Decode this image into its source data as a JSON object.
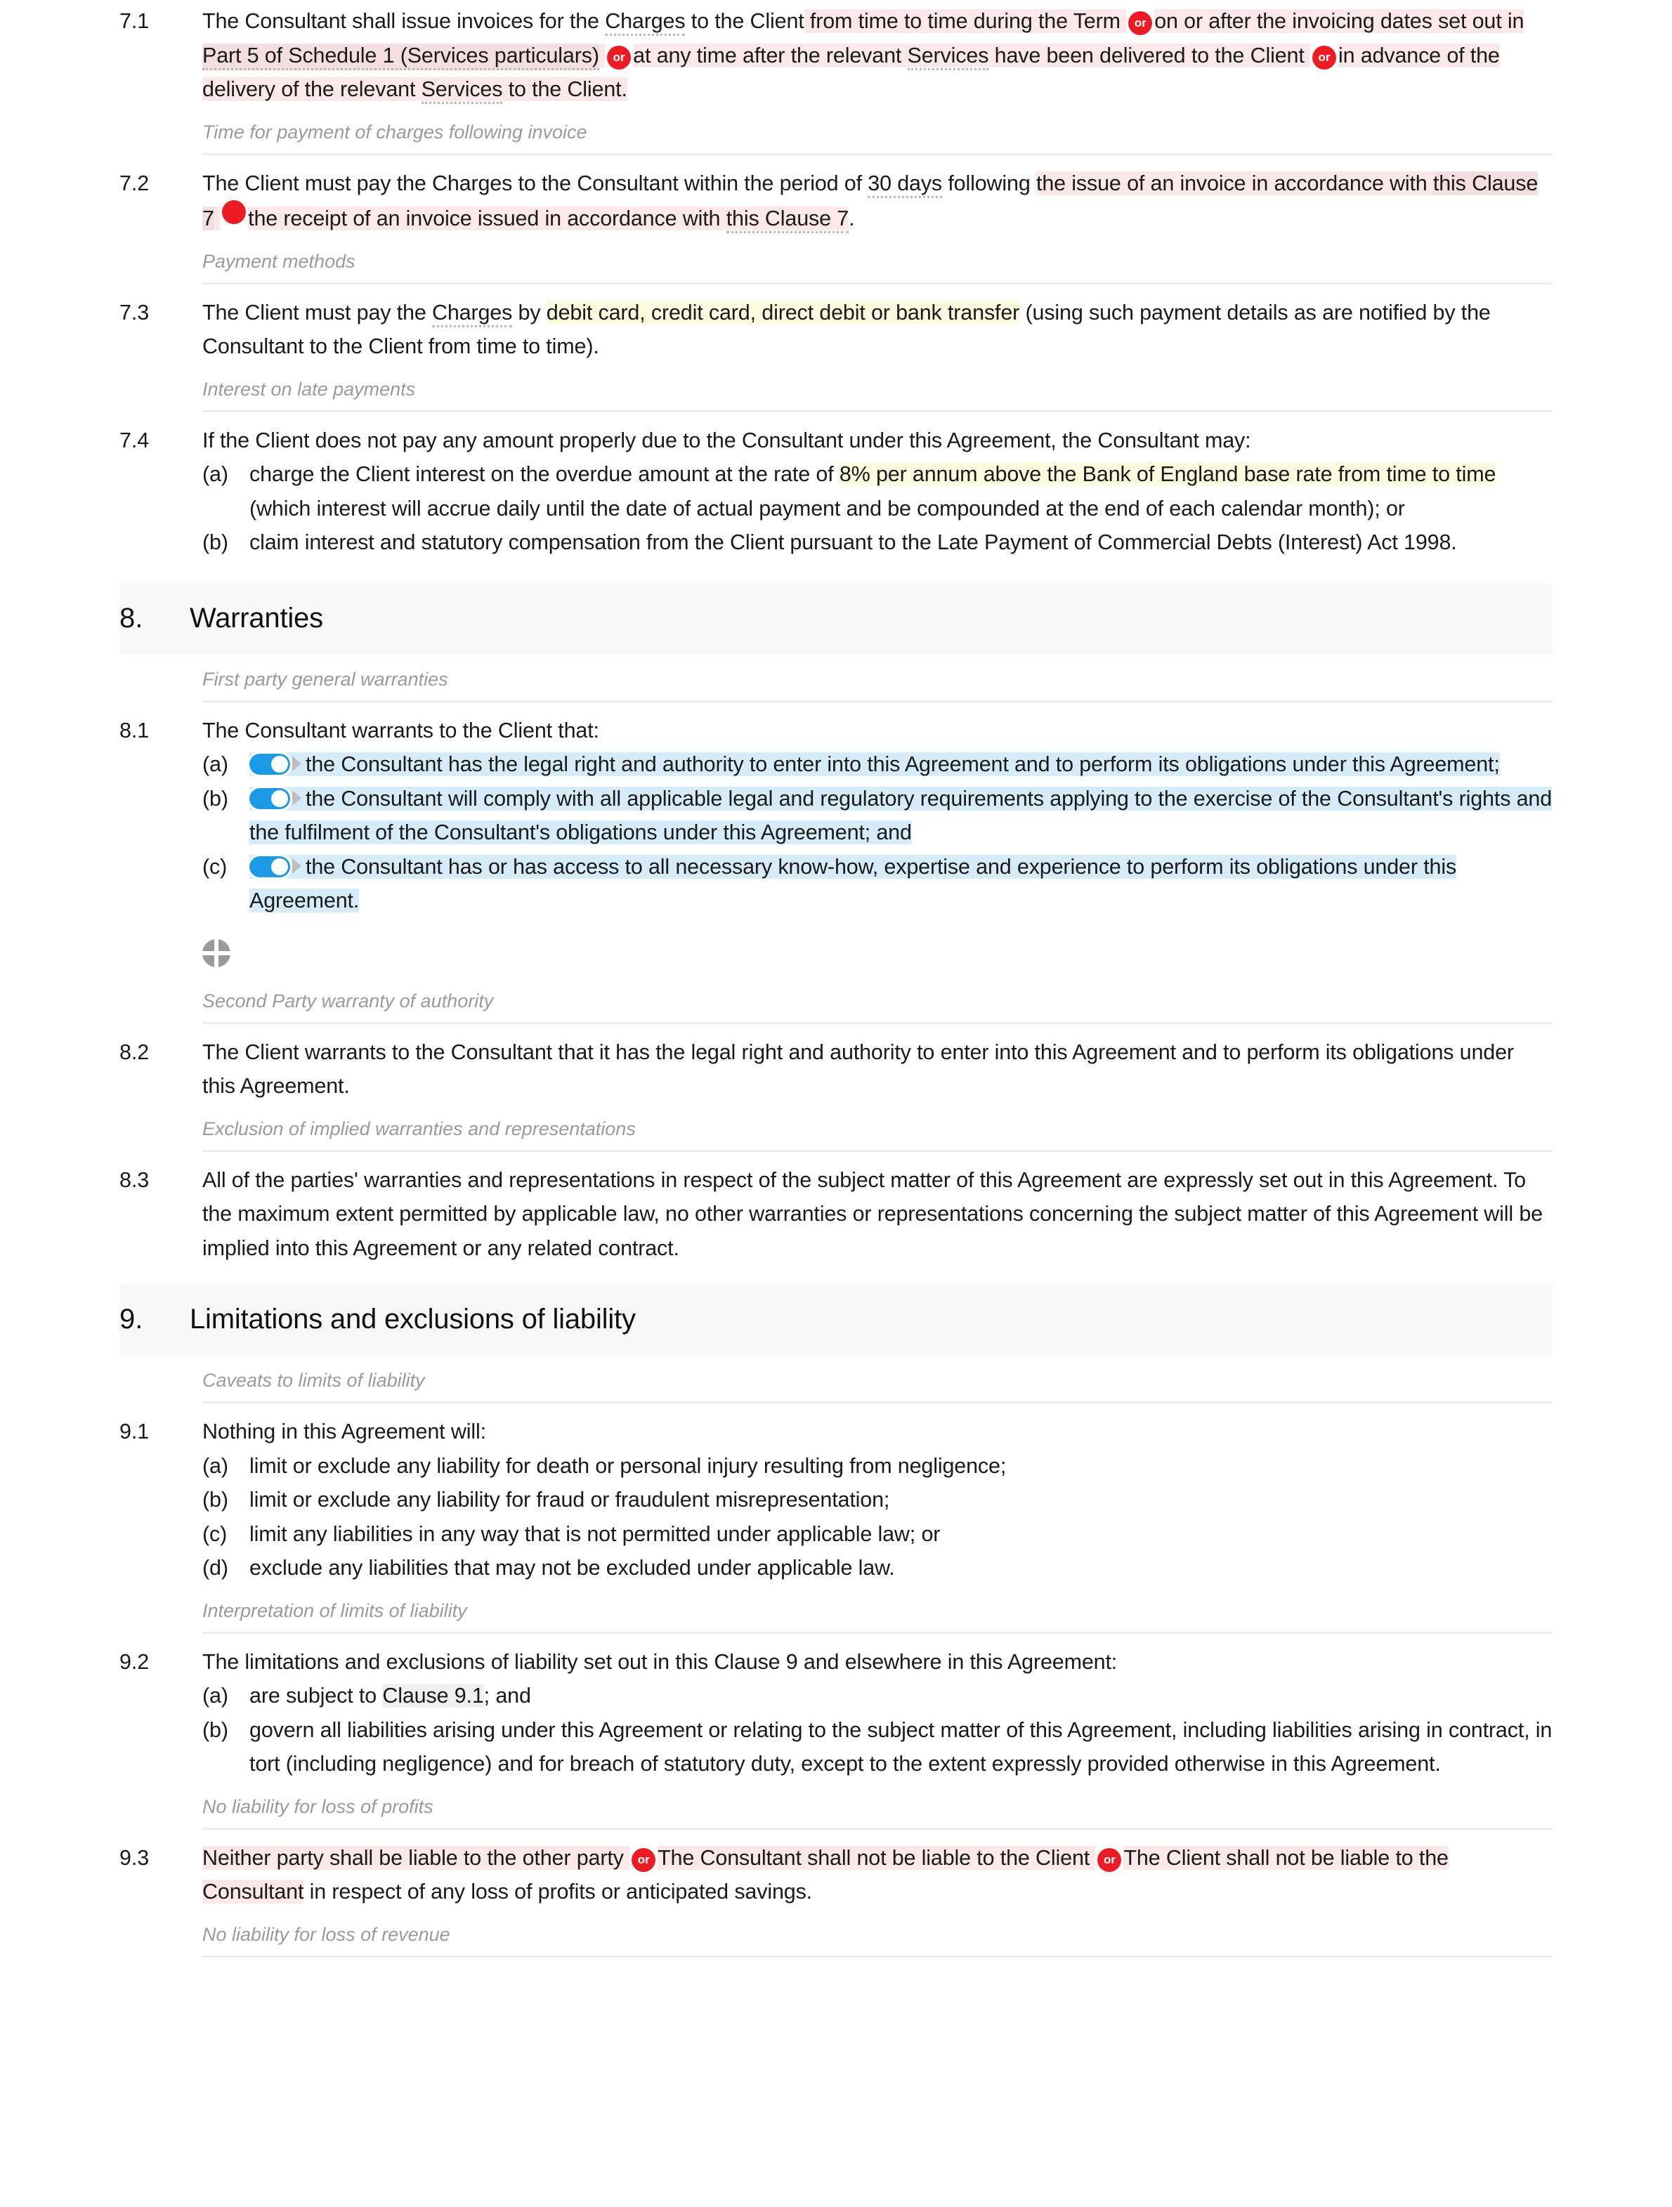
{
  "document": {
    "type": "legal-agreement-editor",
    "clauses": {
      "c71": {
        "number": "7.1",
        "p1": "The Consultant shall issue invoices for the ",
        "term_charges": "Charges",
        "p2": " to the ",
        "term_client": "Client",
        "opt1": "from time to time during the Term",
        "or": "or",
        "opt2a": "on or after the invoicing dates set out in ",
        "xref1": "Part 5 of Schedule 1 (Services particulars)",
        "opt3a": "at any time after the relevant ",
        "term_services": "Services",
        "opt3b": " have been delivered to the ",
        "term_client2": "Client",
        "opt4a": "in advance of the delivery of the relevant ",
        "term_services2": "Services",
        "opt4b": " to the Client."
      },
      "c72": {
        "number": "7.2",
        "p1": "The Client must pay the Charges to the Consultant within the period of ",
        "days": "30 days",
        "p2": " following ",
        "opt1a": "the issue of an invoice in accordance with ",
        "xref1": "this Clause 7",
        "opt2a": "the receipt of an invoice issued in accordance with ",
        "xref2": "this Clause 7",
        "tail": "."
      },
      "c73": {
        "number": "7.3",
        "p1": "The Client must pay the ",
        "term_charges": "Charges",
        "p2": " by ",
        "methods": "debit card, credit card, direct debit or bank transfer",
        "p3": " (using such payment details as are notified by the Consultant to the Client from time to time)."
      },
      "c74": {
        "number": "7.4",
        "lead": "If the Client does not pay any amount properly due to the Consultant under this Agreement, the Consultant may:",
        "items": [
          {
            "label": "(a)",
            "pre": "charge the Client interest on the overdue amount at the rate of ",
            "highlight": "8% per annum above the Bank of England base rate from time to time",
            "post": " (which interest will accrue daily until the date of actual payment and be compounded at the end of each calendar month); or"
          },
          {
            "label": "(b)",
            "pre": "claim interest and statutory compensation from the Client pursuant to the Late Payment of Commercial Debts (Interest) Act 1998.",
            "highlight": "",
            "post": ""
          }
        ]
      },
      "c81": {
        "number": "8.1",
        "lead": "The Consultant warrants to the Client that:",
        "items": [
          {
            "label": "(a)",
            "text": "the Consultant has the legal right and authority to enter into this Agreement and to perform its obligations under this Agreement;"
          },
          {
            "label": "(b)",
            "text": "the Consultant will comply with all applicable legal and regulatory requirements applying to the exercise of the Consultant's rights and the fulfilment of the Consultant's obligations under this Agreement; and"
          },
          {
            "label": "(c)",
            "text": "the Consultant has or has access to all necessary know-how, expertise and experience to perform its obligations under this Agreement."
          }
        ]
      },
      "c82": {
        "number": "8.2",
        "text": "The Client warrants to the Consultant that it has the legal right and authority to enter into this Agreement and to perform its obligations under this Agreement."
      },
      "c83": {
        "number": "8.3",
        "text": "All of the parties' warranties and representations in respect of the subject matter of this Agreement are expressly set out in this Agreement. To the maximum extent permitted by applicable law, no other warranties or representations concerning the subject matter of this Agreement will be implied into this Agreement or any related contract."
      },
      "c91": {
        "number": "9.1",
        "lead": "Nothing in this Agreement will:",
        "items": [
          {
            "label": "(a)",
            "text": "limit or exclude any liability for death or personal injury resulting from negligence;"
          },
          {
            "label": "(b)",
            "text": "limit or exclude any liability for fraud or fraudulent misrepresentation;"
          },
          {
            "label": "(c)",
            "text": "limit any liabilities in any way that is not permitted under applicable law; or"
          },
          {
            "label": "(d)",
            "text": "exclude any liabilities that may not be excluded under applicable law."
          }
        ]
      },
      "c92": {
        "number": "9.2",
        "lead": "The limitations and exclusions of liability set out in this Clause 9 and elsewhere in this Agreement:",
        "item_a_pre": "are subject to ",
        "item_a_xref": "Clause 9.1",
        "item_a_post": "; and",
        "item_a_label": "(a)",
        "item_b_label": "(b)",
        "item_b": "govern all liabilities arising under this Agreement or relating to the subject matter of this Agreement, including liabilities arising in contract, in tort (including negligence) and for breach of statutory duty, except to the extent expressly provided otherwise in this Agreement."
      },
      "c93": {
        "number": "9.3",
        "opt1": "Neither party shall be liable to the other party",
        "or": "or",
        "opt2": "The Consultant shall not be liable to the Client",
        "opt3": "The Client shall not be liable to the Consultant",
        "tail": " in respect of any loss of profits or anticipated savings."
      }
    },
    "sections": [
      {
        "number": "8.",
        "title": "Warranties"
      },
      {
        "number": "9.",
        "title": "Limitations and exclusions of liability"
      }
    ],
    "subheadings": {
      "s1": "Time for payment of charges following invoice",
      "s2": "Payment methods",
      "s3": "Interest on late payments",
      "s4": "First party general warranties",
      "s5": "Second Party warranty of authority",
      "s6": "Exclusion of implied warranties and representations",
      "s7": "Caveats to limits of liability",
      "s8": "Interpretation of limits of liability",
      "s9": "No liability for loss of profits",
      "s10": "No liability for loss of revenue"
    },
    "icons": {
      "or_badge": "or",
      "insert_widget": "quadrant-circle-icon",
      "toggle_on": "toggle-switch-on"
    },
    "colors": {
      "highlight_pink": "#fce8e8",
      "highlight_pink_dark": "#f4dede",
      "highlight_yellow": "#fbfbe0",
      "highlight_blue": "#d6ecfb",
      "highlight_gray": "#f0f0f0",
      "badge_red": "#ed1c24",
      "toggle_blue": "#1c9ae6",
      "section_band": "#f8f8f8",
      "subhead_gray": "#9a9a9a"
    }
  }
}
